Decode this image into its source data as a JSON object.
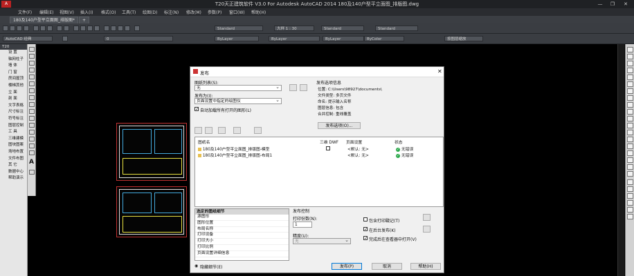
{
  "window": {
    "title": "T20天正建筑软件 V3.0 For Autodesk AutoCAD 2014    180及140户型平立面图_排版图.dwg",
    "logo": "A",
    "minimize": "—",
    "restore": "❐",
    "close": "✕"
  },
  "menu": [
    "文件(F)",
    "编辑(E)",
    "视图(V)",
    "插入(I)",
    "格式(O)",
    "工具(T)",
    "绘图(D)",
    "标注(N)",
    "修改(M)",
    "参数(P)",
    "窗口(W)",
    "帮助(H)"
  ],
  "tabs": [
    {
      "label": "180及140户型平立面图_排版图*"
    },
    {
      "label": "+"
    }
  ],
  "toolbar": {
    "style_combo": "Standard",
    "scale_combo": "大样 1 : 30",
    "text_style": "Standard",
    "dim_style": "Standard",
    "workspace": "AutoCAD 经典",
    "layer": "0",
    "color": "ByLayer",
    "linetype": "ByLayer",
    "lineweight": "ByLayer",
    "plotstyle": "ByColor",
    "annotate": "按图层缩放"
  },
  "palette": {
    "header": "T20",
    "items": [
      "设 置",
      "轴网柱子",
      "墙 体",
      "门 窗",
      "房间屋顶",
      "楼梯其他",
      "立 面",
      "剖 面",
      "文字表格",
      "尺寸标注",
      "符号标注",
      "图层控制",
      "工 具",
      "三维建模",
      "图块图案",
      "场地布置",
      "文件布图",
      "其 它",
      "数据中心",
      "帮助演示"
    ]
  },
  "dialog": {
    "title": "发布",
    "close": "✕",
    "sheet_list_label": "图纸列表(S):",
    "sheet_list_value": "无",
    "publish_to_label": "发布为(I):",
    "publish_to_value": "页面设置中指定的绘图仪",
    "auto_load_label": "自动加载所有打开的图形(L)",
    "info": {
      "header": "发布选项信息",
      "location": "位置: C:\\Users\\98927\\documents\\",
      "file_type": "文件类型: 多页文件",
      "naming": "命名: 提示输入名称",
      "layer_info": "图层信息: 包含",
      "merge": "合并控制: 重线覆盖",
      "options_btn": "发布选项(O)..."
    },
    "columns": {
      "name": "图纸名",
      "threed": "三维 DWF",
      "page_setup": "页面设置",
      "status": "状态"
    },
    "sheets": [
      {
        "name": "180及140户型平立面图_排版图-模型",
        "page_setup": "<默认: 无>",
        "status": "无错误"
      },
      {
        "name": "180及140户型平立面图_排版图-布局1",
        "page_setup": "<默认: 无>",
        "status": "无错误"
      }
    ],
    "details": {
      "header": "选定的图纸细节",
      "items": [
        "源图形",
        "图形位置",
        "布局名称",
        "打印设备",
        "打印大小",
        "打印比例",
        "页面设置详细信息"
      ]
    },
    "publish_control": {
      "label": "发布控制",
      "copies_label": "打印份数(N):",
      "copies_value": "1",
      "precision_label": "精度(U):",
      "precision_value": "无",
      "stamp_label": "包含打印戳记(T)",
      "background_label": "在后台发布(K)",
      "open_viewer_label": "完成后在查看器中打开(V)"
    },
    "hide_details": "隐藏细节(E)",
    "publish_btn": "发布(P)",
    "cancel_btn": "取消",
    "help_btn": "帮助(H)"
  }
}
